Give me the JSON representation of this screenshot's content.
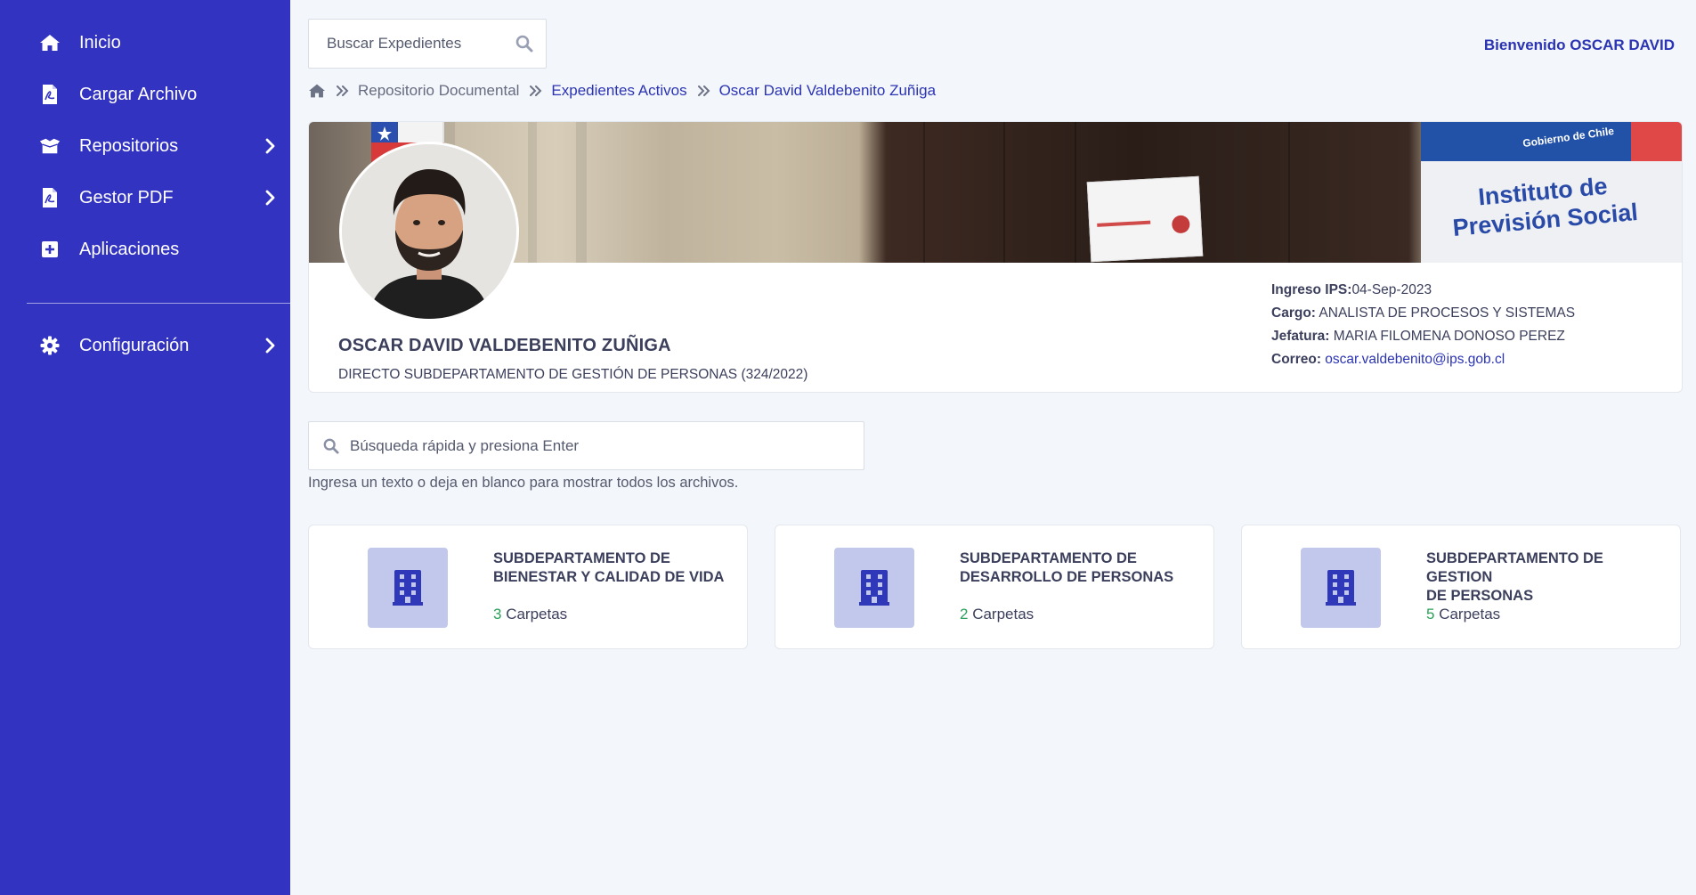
{
  "sidebar": {
    "items": [
      {
        "label": "Inicio",
        "icon": "home-icon"
      },
      {
        "label": "Cargar Archivo",
        "icon": "file-pdf-icon"
      },
      {
        "label": "Repositorios",
        "icon": "box-open-icon",
        "has_submenu": true
      },
      {
        "label": "Gestor PDF",
        "icon": "file-pdf-icon",
        "has_submenu": true
      },
      {
        "label": "Aplicaciones",
        "icon": "plus-square-icon"
      }
    ],
    "settings": {
      "label": "Configuración",
      "icon": "gear-icon",
      "has_submenu": true
    },
    "background_color": "#3333c2"
  },
  "header": {
    "search_placeholder": "Buscar Expedientes",
    "welcome": "Bienvenido OSCAR DAVID"
  },
  "breadcrumb": {
    "items": [
      "Repositorio Documental",
      "Expedientes Activos"
    ],
    "current": "Oscar David Valdebenito Zuñiga"
  },
  "profile": {
    "name": "OSCAR DAVID VALDEBENITO ZUÑIGA",
    "department": "DIRECTO SUBDEPARTAMENTO DE GESTIÓN DE PERSONAS (324/2022)",
    "banner_sign": {
      "gov_label": "Gobierno de Chile",
      "institution_line1": "Instituto de",
      "institution_line2": "Previsión Social"
    },
    "info": {
      "ingreso_label": "Ingreso IPS:",
      "ingreso_value": "04-Sep-2023",
      "cargo_label": "Cargo:",
      "cargo_value": "ANALISTA DE PROCESOS Y SISTEMAS",
      "jefatura_label": "Jefatura:",
      "jefatura_value": "MARIA FILOMENA DONOSO PEREZ",
      "correo_label": "Correo:",
      "correo_value": "oscar.valdebenito@ips.gob.cl"
    }
  },
  "quick_search": {
    "placeholder": "Búsqueda rápida y presiona Enter",
    "hint": "Ingresa un texto o deja en blanco para mostrar todos los archivos."
  },
  "departments": [
    {
      "line1": "SUBDEPARTAMENTO DE",
      "line2": "BIENESTAR Y CALIDAD DE VIDA",
      "count": "3",
      "count_label": "Carpetas"
    },
    {
      "line1": "SUBDEPARTAMENTO DE",
      "line2": "DESARROLLO DE PERSONAS",
      "count": "2",
      "count_label": "Carpetas"
    },
    {
      "line1": "SUBDEPARTAMENTO DE GESTION",
      "line2": "DE PERSONAS",
      "count": "5",
      "count_label": "Carpetas"
    }
  ],
  "colors": {
    "accent": "#2b34b3",
    "count_green": "#2ca05a",
    "icon_tile": "#c2c8ec"
  }
}
